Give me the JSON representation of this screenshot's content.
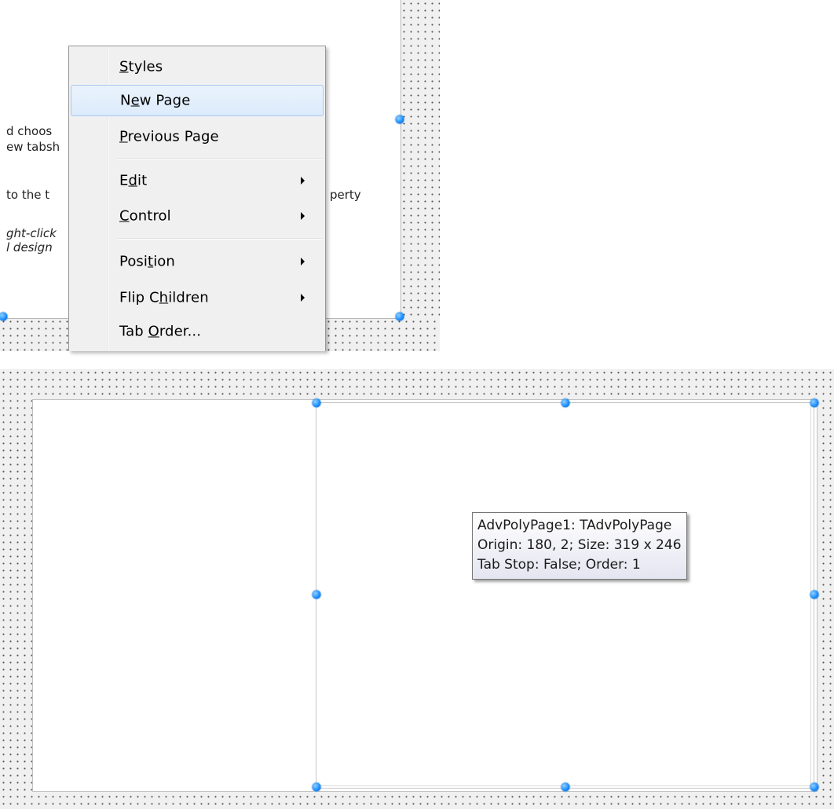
{
  "form_text_behind_menu": [
    "d choos",
    "ew tabsh",
    "to the t",
    "perty",
    "ght-click",
    "l design"
  ],
  "context_menu": {
    "items": [
      {
        "id": "styles",
        "pre": "",
        "u": "S",
        "post": "tyles",
        "submenu": false,
        "highlighted": false
      },
      {
        "id": "new-page",
        "pre": "N",
        "u": "e",
        "post": "w Page",
        "submenu": false,
        "highlighted": true
      },
      {
        "id": "previous-page",
        "pre": "",
        "u": "P",
        "post": "revious Page",
        "submenu": false,
        "highlighted": false
      },
      {
        "id": "edit",
        "pre": "E",
        "u": "d",
        "post": "it",
        "submenu": true,
        "highlighted": false
      },
      {
        "id": "control",
        "pre": "",
        "u": "C",
        "post": "ontrol",
        "submenu": true,
        "highlighted": false
      },
      {
        "id": "position",
        "pre": "Posi",
        "u": "t",
        "post": "ion",
        "submenu": true,
        "highlighted": false
      },
      {
        "id": "flip-children",
        "pre": "Flip C",
        "u": "h",
        "post": "ildren",
        "submenu": true,
        "highlighted": false
      },
      {
        "id": "tab-order",
        "pre": "Tab ",
        "u": "O",
        "post": "rder...",
        "submenu": false,
        "highlighted": false
      }
    ]
  },
  "hint_tooltip": {
    "line1": "AdvPolyPage1: TAdvPolyPage",
    "line2": "Origin: 180, 2; Size: 319 x 246",
    "line3": "Tab Stop: False; Order: 1"
  },
  "colors": {
    "handle": "#1e90ff",
    "menu_highlight": "#dcebfc",
    "menu_background": "#f0f0f0",
    "tooltip_border": "#767676"
  }
}
